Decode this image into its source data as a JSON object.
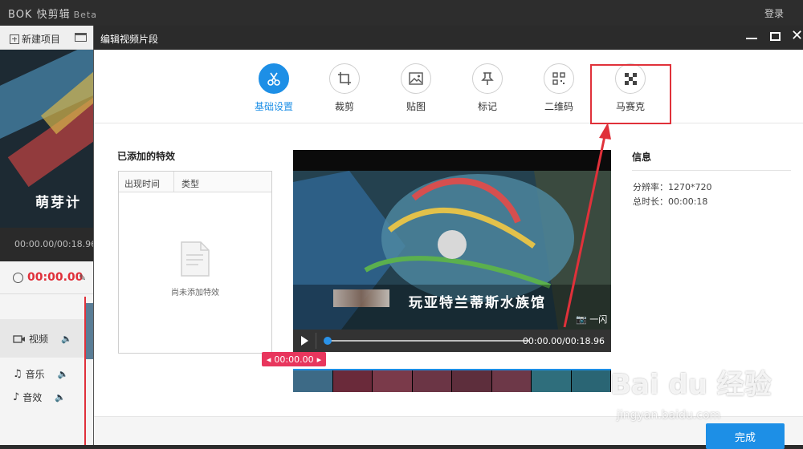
{
  "app": {
    "logo": "BOK 快剪辑",
    "beta": "Beta",
    "login": "登录",
    "new_project": "新建项目",
    "background_caption": "萌芽计",
    "time_display": "00:00.00/00:18.96",
    "current_time": "00:00.00",
    "tracks": [
      {
        "label": "视频"
      },
      {
        "label": "音乐"
      },
      {
        "label": "音效"
      }
    ]
  },
  "dialog": {
    "title": "编辑视频片段",
    "tabs": [
      {
        "label": "基础设置",
        "icon": "scissors-icon",
        "active": true
      },
      {
        "label": "裁剪",
        "icon": "crop-icon",
        "active": false
      },
      {
        "label": "贴图",
        "icon": "image-icon",
        "active": false
      },
      {
        "label": "标记",
        "icon": "pin-icon",
        "active": false
      },
      {
        "label": "二维码",
        "icon": "qrcode-icon",
        "active": false
      },
      {
        "label": "马赛克",
        "icon": "mosaic-icon",
        "active": false
      }
    ],
    "effects": {
      "title": "已添加的特效",
      "columns": [
        "出现时间",
        "类型"
      ],
      "empty": "尚未添加特效"
    },
    "video": {
      "caption": "玩亚特兰蒂斯水族馆",
      "blurred_prefix": "到",
      "snapshot": "一闪",
      "time": "00:00.00/00:18.96",
      "progress": 0.0
    },
    "marker_time": "00:00.00",
    "info": {
      "title": "信息",
      "resolution_label": "分辨率：",
      "resolution": "1270*720",
      "duration_label": "总时长：",
      "duration": "00:00:18"
    },
    "done_button": "完成"
  },
  "watermark": {
    "main": "Bai du 经验",
    "sub": "jingyan.baidu.com"
  },
  "colors": {
    "accent": "#1d8fe6",
    "highlight": "#e0313a",
    "marker": "#e8365d"
  }
}
